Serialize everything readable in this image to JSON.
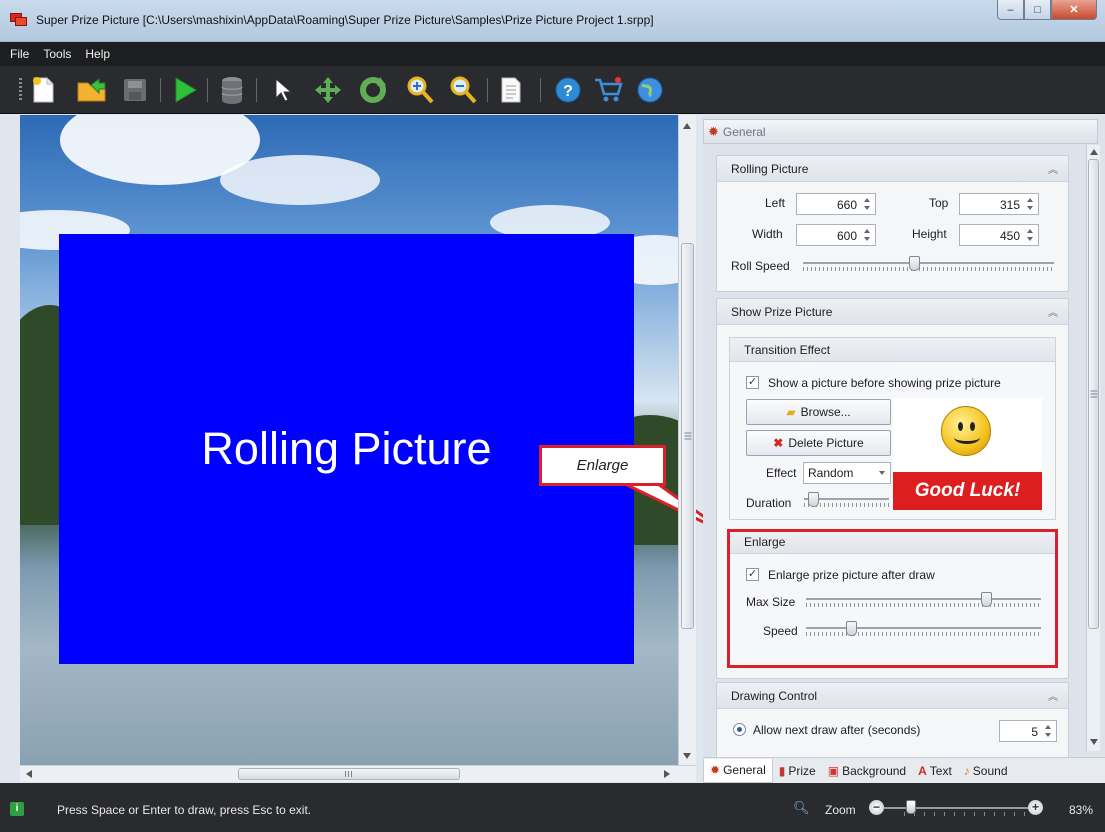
{
  "window": {
    "title": "Super Prize Picture [C:\\Users\\mashixin\\AppData\\Roaming\\Super Prize Picture\\Samples\\Prize Picture Project 1.srpp]",
    "minimize": "‒",
    "maximize": "□",
    "close": "✕"
  },
  "menu": {
    "items": [
      "File",
      "Tools",
      "Help"
    ]
  },
  "toolbar": {
    "buttons": [
      "new-project",
      "open-project",
      "save-project",
      "start-draw",
      "database",
      "select-tool",
      "move-tool",
      "rotate-tool",
      "zoom-in",
      "zoom-out",
      "document",
      "help",
      "buy",
      "web"
    ]
  },
  "canvas": {
    "rolling_text": "Rolling Picture",
    "rolling_color": "#0000fe"
  },
  "callout": {
    "text": "Enlarge"
  },
  "panel": {
    "header": "General",
    "rolling_picture": {
      "title": "Rolling Picture",
      "left_label": "Left",
      "left_value": "660",
      "top_label": "Top",
      "top_value": "315",
      "width_label": "Width",
      "width_value": "600",
      "height_label": "Height",
      "height_value": "450",
      "roll_speed_label": "Roll Speed",
      "roll_speed_level": 0.44
    },
    "show_prize": {
      "title": "Show Prize Picture",
      "transition": {
        "title": "Transition Effect",
        "checkbox_label": "Show a picture before showing prize picture",
        "checked": true,
        "browse_label": "Browse...",
        "delete_label": "Delete Picture",
        "effect_label": "Effect",
        "effect_value": "Random",
        "duration_label": "Duration",
        "duration_level": 0.05,
        "preview_text": "Good Luck!"
      },
      "enlarge": {
        "title": "Enlarge",
        "checkbox_label": "Enlarge prize picture after draw",
        "checked": true,
        "max_size_label": "Max Size",
        "max_size_level": 0.78,
        "speed_label": "Speed",
        "speed_level": 0.18
      }
    },
    "drawing_control": {
      "title": "Drawing Control",
      "radio_label": "Allow next draw after (seconds)",
      "seconds_value": "5"
    }
  },
  "tabs": [
    {
      "label": "General",
      "icon": "gear-icon"
    },
    {
      "label": "Prize",
      "icon": "prize-icon"
    },
    {
      "label": "Background",
      "icon": "background-icon"
    },
    {
      "label": "Text",
      "icon": "text-icon"
    },
    {
      "label": "Sound",
      "icon": "sound-icon"
    }
  ],
  "status": {
    "message": "Press Space or Enter to draw, press Esc to exit.",
    "zoom_label": "Zoom",
    "zoom_minus": "−",
    "zoom_plus": "+",
    "zoom_percent": "83%"
  },
  "colors": {
    "accent_red": "#d8212a",
    "toolbar_bg": "#2a2b2e",
    "good_luck_bg": "#dd1e1e"
  }
}
